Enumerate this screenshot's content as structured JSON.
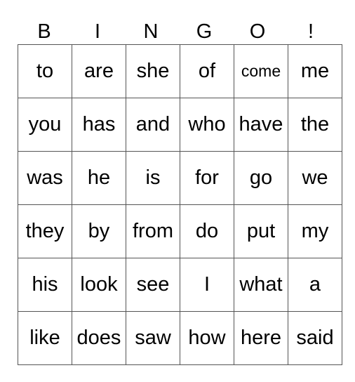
{
  "header": [
    "B",
    "I",
    "N",
    "G",
    "O",
    "!"
  ],
  "rows": [
    [
      "to",
      "are",
      "she",
      "of",
      "come",
      "me"
    ],
    [
      "you",
      "has",
      "and",
      "who",
      "have",
      "the"
    ],
    [
      "was",
      "he",
      "is",
      "for",
      "go",
      "we"
    ],
    [
      "they",
      "by",
      "from",
      "do",
      "put",
      "my"
    ],
    [
      "his",
      "look",
      "see",
      "I",
      "what",
      "a"
    ],
    [
      "like",
      "does",
      "saw",
      "how",
      "here",
      "said"
    ]
  ]
}
